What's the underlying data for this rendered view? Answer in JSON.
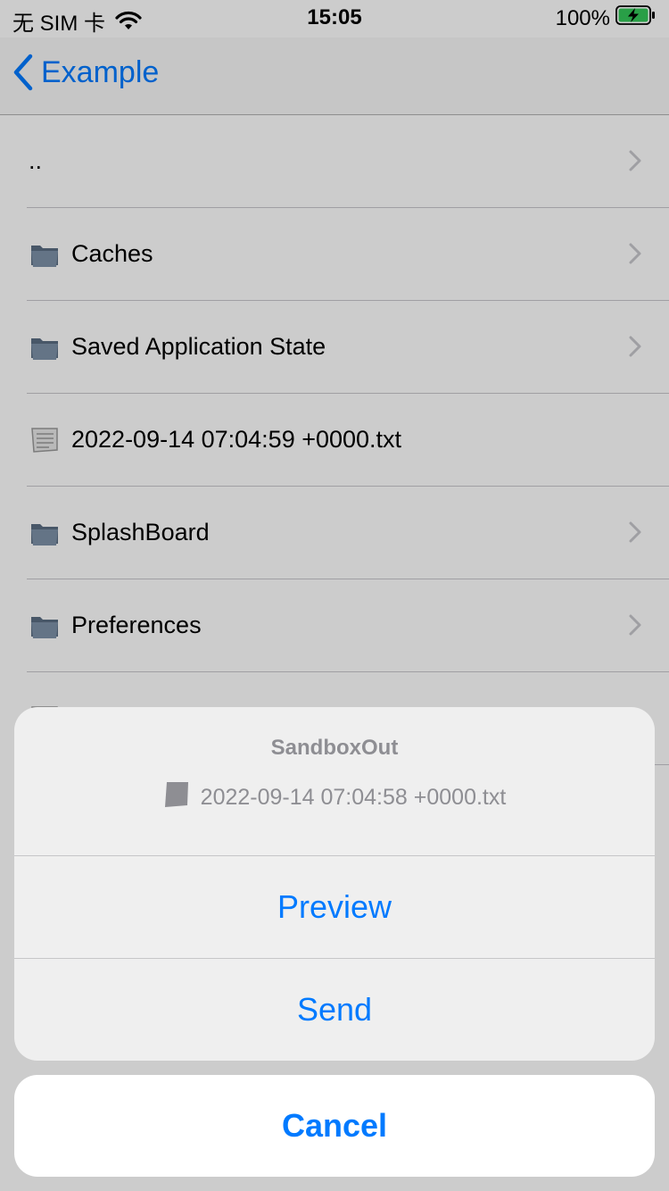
{
  "status_bar": {
    "carrier": "无 SIM 卡",
    "time": "15:05",
    "battery": "100%",
    "colors": {
      "battery_fill": "#34c759"
    }
  },
  "nav": {
    "back_label": "Example"
  },
  "list": {
    "items": [
      {
        "label": "..",
        "type": "parent",
        "icon": "none"
      },
      {
        "label": "Caches",
        "type": "folder",
        "icon": "folder-icon"
      },
      {
        "label": "Saved Application State",
        "type": "folder",
        "icon": "folder-icon"
      },
      {
        "label": "2022-09-14 07:04:59 +0000.txt",
        "type": "file",
        "icon": "document-icon"
      },
      {
        "label": "SplashBoard",
        "type": "folder",
        "icon": "folder-icon"
      },
      {
        "label": "Preferences",
        "type": "folder",
        "icon": "folder-icon"
      }
    ]
  },
  "action_sheet": {
    "title": "SandboxOut",
    "message_file": "2022-09-14 07:04:58 +0000.txt",
    "actions": [
      "Preview",
      "Send"
    ],
    "cancel": "Cancel",
    "colors": {
      "accent": "#007aff"
    }
  }
}
